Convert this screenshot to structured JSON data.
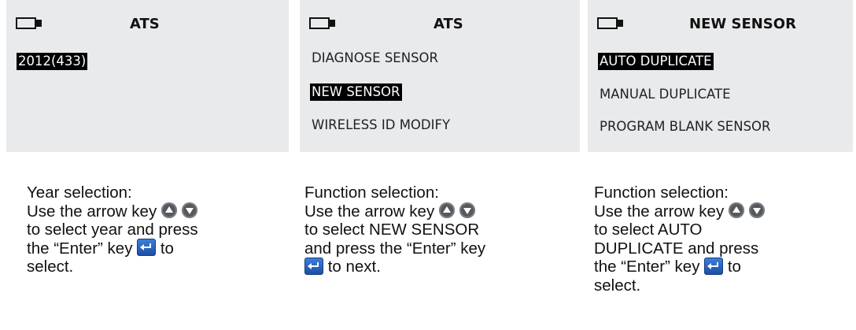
{
  "screens": [
    {
      "title": "ATS",
      "items": [
        {
          "label": "2012(433)",
          "selected": true
        }
      ]
    },
    {
      "title": "ATS",
      "items": [
        {
          "label": "DIAGNOSE SENSOR",
          "selected": false
        },
        {
          "label": "NEW SENSOR",
          "selected": true
        },
        {
          "label": "WIRELESS ID MODIFY",
          "selected": false
        }
      ]
    },
    {
      "title": "NEW SENSOR",
      "items": [
        {
          "label": "AUTO DUPLICATE",
          "selected": true
        },
        {
          "label": "MANUAL DUPLICATE",
          "selected": false
        },
        {
          "label": "PROGRAM BLANK SENSOR",
          "selected": false
        }
      ]
    }
  ],
  "captions": [
    {
      "heading": "Year selection:",
      "line1": "Use the arrow key",
      "line2": "to select year and press",
      "line3_pre": "the “Enter” key",
      "line3_post": "to",
      "line4": "select."
    },
    {
      "heading": "Function selection:",
      "line1": "Use the arrow key",
      "line2": "to select NEW SENSOR",
      "line3": "and press the “Enter” key",
      "line4_post": "to next."
    },
    {
      "heading": "Function selection:",
      "line1": "Use the arrow key",
      "line2": "to select AUTO",
      "line3": "DUPLICATE and press",
      "line4_pre": "the “Enter” key",
      "line4_post": "to",
      "line5": "select."
    }
  ],
  "icons": {
    "battery": "battery-icon",
    "arrow_up": "arrow-up-key-icon",
    "arrow_down": "arrow-down-key-icon",
    "enter": "enter-key-icon"
  },
  "colors": {
    "screen_bg": "#e9eaec",
    "selected_bg": "#000000",
    "enter_key": "#2a63bf"
  }
}
